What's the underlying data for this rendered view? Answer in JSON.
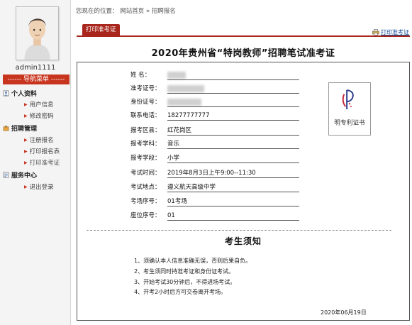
{
  "user": {
    "name": "admin1111"
  },
  "sidebar": {
    "header": "------ 导航菜单 ------",
    "sections": [
      {
        "title": "个人资料",
        "icon": "person-icon",
        "items": [
          {
            "label": "用户信息"
          },
          {
            "label": "修改密码"
          }
        ]
      },
      {
        "title": "招聘管理",
        "icon": "briefcase-icon",
        "items": [
          {
            "label": "注册报名"
          },
          {
            "label": "打印报名表"
          },
          {
            "label": "打印准考证"
          }
        ]
      },
      {
        "title": "服务中心",
        "icon": "service-icon",
        "items": [
          {
            "label": "退出登录"
          }
        ]
      }
    ]
  },
  "breadcrumb": {
    "prefix": "您现在的位置：",
    "home": "网站首页",
    "sep": "»",
    "current": "招聘报名"
  },
  "tab": {
    "label": "打印准考证"
  },
  "print_link": "打印准考证",
  "card": {
    "title": "2020年贵州省“特岗教师”招聘笔试准考证",
    "fields": [
      {
        "label": "姓    名：",
        "value": "",
        "redacted": true
      },
      {
        "label": "准考证号：",
        "value": "",
        "redacted": true
      },
      {
        "label": "身份证号：",
        "value": "",
        "redacted": true
      },
      {
        "label": "联系电话：",
        "value": "18277777777"
      },
      {
        "label": "报考区县：",
        "value": "红花岗区"
      },
      {
        "label": "报考学科：",
        "value": "音乐"
      },
      {
        "label": "报考学段：",
        "value": "小学"
      },
      {
        "label": "考试时间：",
        "value": "2019年8月3日上午9:00--11:30"
      },
      {
        "label": "考试地点：",
        "value": "遵义航天高级中学"
      },
      {
        "label": "考场序号：",
        "value": "01考场"
      },
      {
        "label": "座位序号：",
        "value": "01"
      }
    ],
    "photo_caption": "明专利证书"
  },
  "notice": {
    "title": "考生须知",
    "items": [
      "1、须确认本人信息准确无误，否则后果自负。",
      "2、考生须同时持准考证和身份证考试。",
      "3、开始考试30分钟后，不得进场考试。",
      "4、开考2小时后方可交卷离开考场。"
    ],
    "date": "2020年06月19日"
  },
  "colors": {
    "accent": "#a8261c",
    "nav_header": "#c8351f",
    "link": "#1a4e9a"
  }
}
